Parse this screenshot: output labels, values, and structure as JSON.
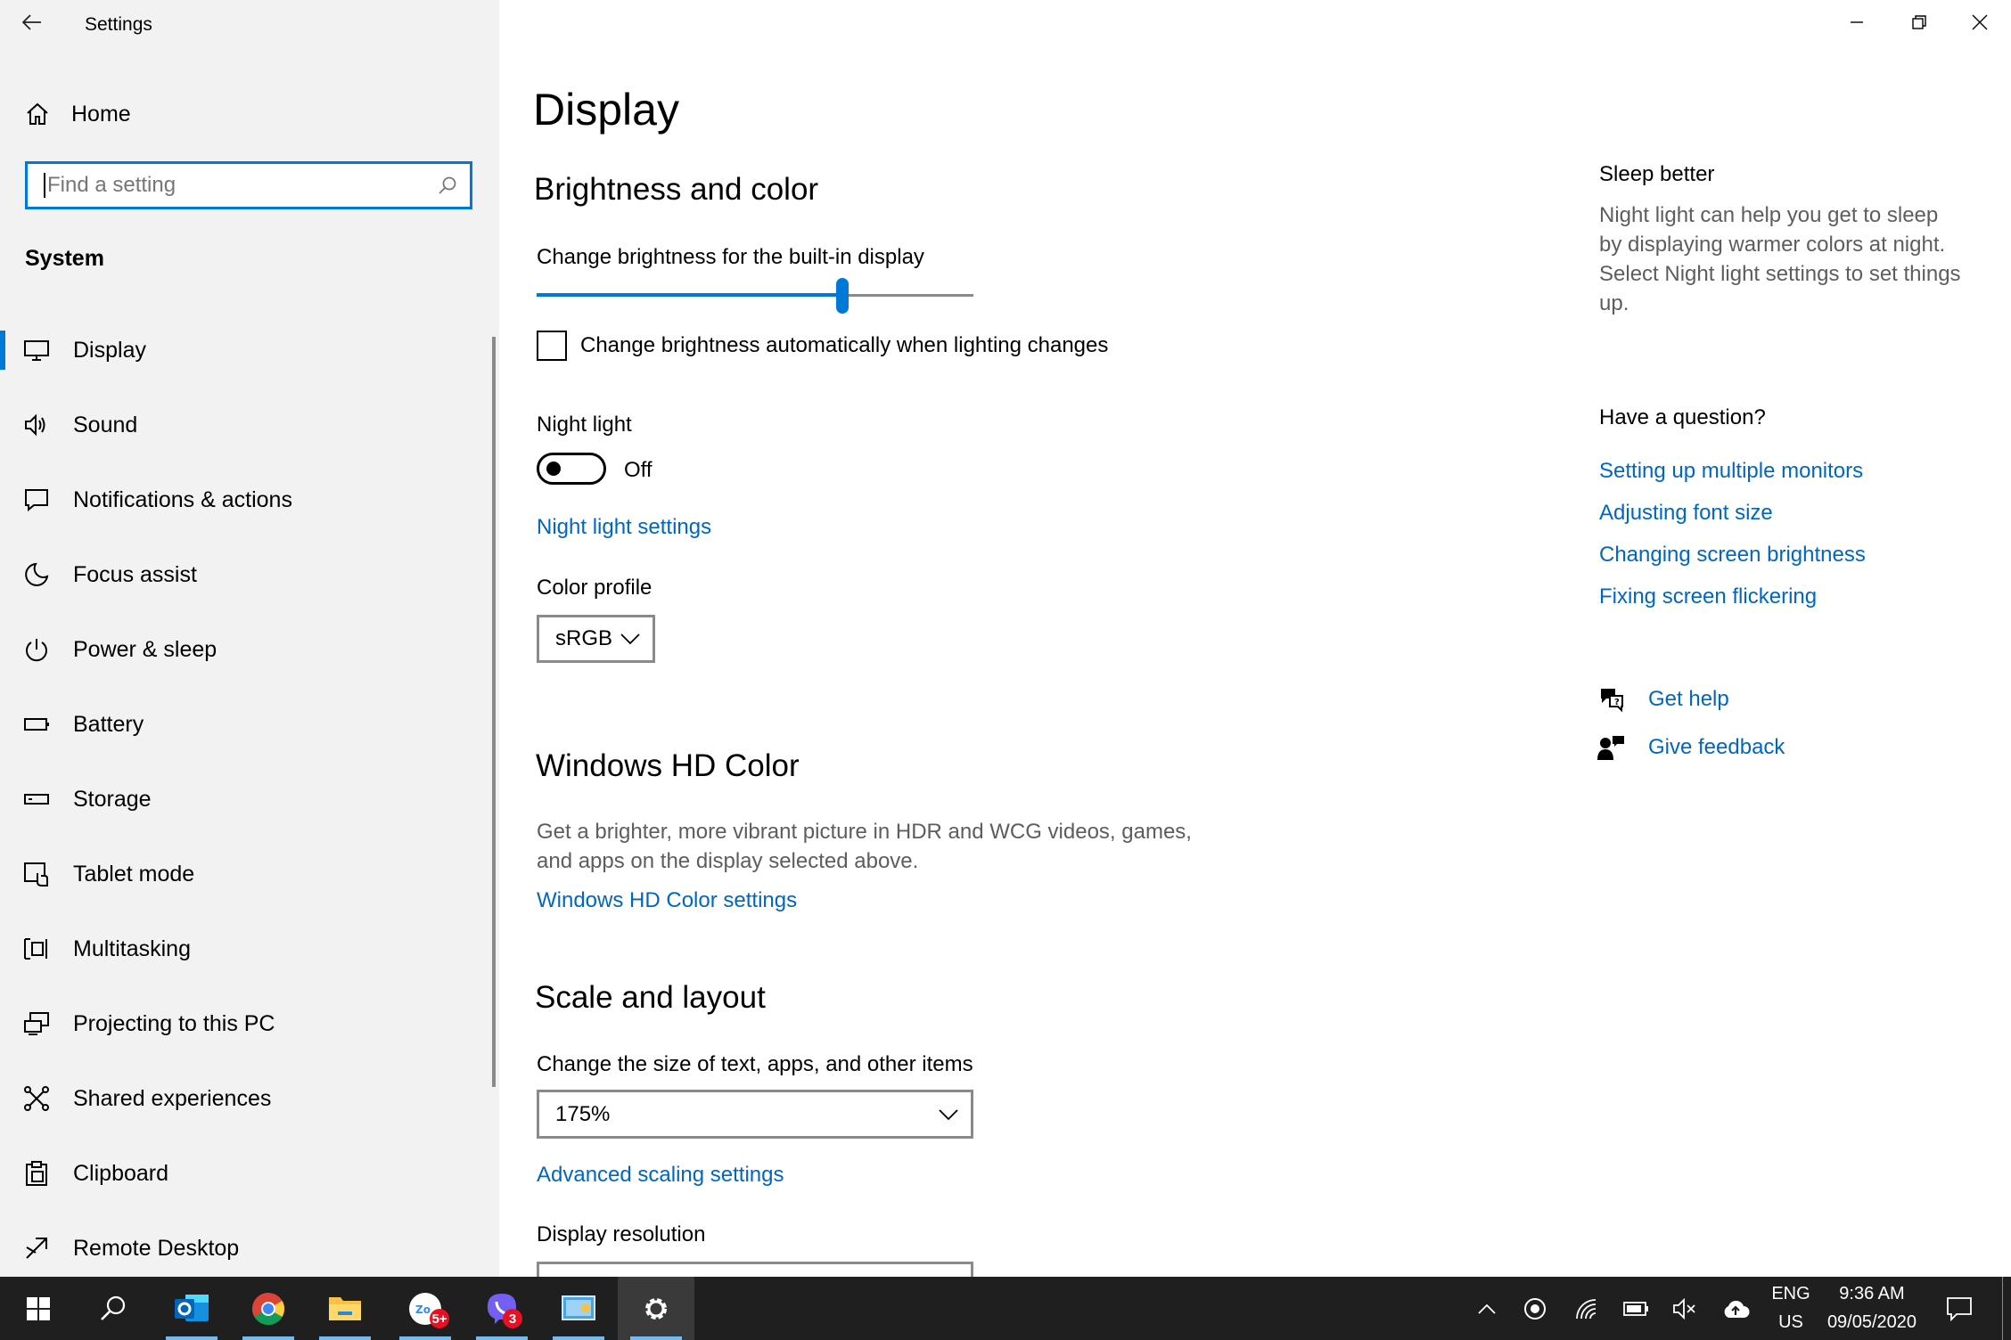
{
  "window": {
    "title": "Settings"
  },
  "sidebar": {
    "home_label": "Home",
    "search_placeholder": "Find a setting",
    "section": "System",
    "items": [
      {
        "label": "Display",
        "icon": "monitor-icon",
        "active": true
      },
      {
        "label": "Sound",
        "icon": "speaker-icon"
      },
      {
        "label": "Notifications & actions",
        "icon": "notification-icon"
      },
      {
        "label": "Focus assist",
        "icon": "moon-icon"
      },
      {
        "label": "Power & sleep",
        "icon": "power-icon"
      },
      {
        "label": "Battery",
        "icon": "battery-icon"
      },
      {
        "label": "Storage",
        "icon": "storage-icon"
      },
      {
        "label": "Tablet mode",
        "icon": "tablet-mode-icon"
      },
      {
        "label": "Multitasking",
        "icon": "multitasking-icon"
      },
      {
        "label": "Projecting to this PC",
        "icon": "projecting-icon"
      },
      {
        "label": "Shared experiences",
        "icon": "shared-experiences-icon"
      },
      {
        "label": "Clipboard",
        "icon": "clipboard-icon"
      },
      {
        "label": "Remote Desktop",
        "icon": "remote-desktop-icon"
      }
    ]
  },
  "main": {
    "title": "Display",
    "brightness": {
      "heading": "Brightness and color",
      "slider_label": "Change brightness for the built-in display",
      "slider_value_fraction": 0.7,
      "auto_checkbox_label": "Change brightness automatically when lighting changes",
      "auto_checked": false
    },
    "night_light": {
      "label": "Night light",
      "state": "Off",
      "settings_link": "Night light settings"
    },
    "color_profile": {
      "label": "Color profile",
      "value": "sRGB"
    },
    "hd_color": {
      "heading": "Windows HD Color",
      "description_line1": "Get a brighter, more vibrant picture in HDR and WCG videos, games,",
      "description_line2": "and apps on the display selected above.",
      "settings_link": "Windows HD Color settings"
    },
    "scale": {
      "heading": "Scale and layout",
      "size_label": "Change the size of text, apps, and other items",
      "size_value": "175%",
      "advanced_link": "Advanced scaling settings",
      "resolution_label": "Display resolution"
    }
  },
  "aside": {
    "sleep_title": "Sleep better",
    "sleep_lines": [
      "Night light can help you get to sleep",
      "by displaying warmer colors at night.",
      "Select Night light settings to set things",
      "up."
    ],
    "question_title": "Have a question?",
    "links": [
      "Setting up multiple monitors",
      "Adjusting font size",
      "Changing screen brightness",
      "Fixing screen flickering"
    ],
    "get_help": "Get help",
    "give_feedback": "Give feedback"
  },
  "taskbar": {
    "zoom_badge": "5+",
    "viber_badge": "3",
    "lang_top": "ENG",
    "lang_bottom": "US",
    "time": "9:36 AM",
    "date": "09/05/2020"
  },
  "colors": {
    "accent": "#0078d7",
    "link": "#0067c0",
    "sidebar": "#f2f2f2",
    "taskbar": "#1f1f1f"
  }
}
